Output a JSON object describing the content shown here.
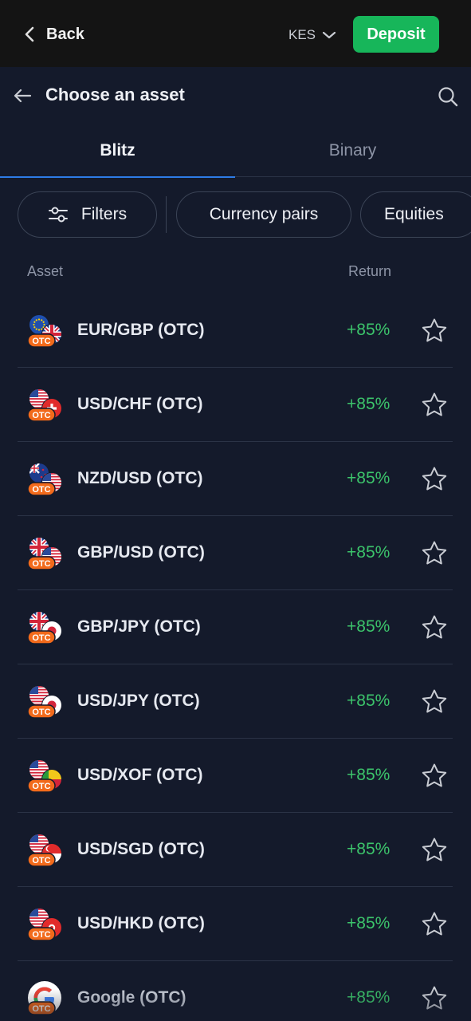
{
  "topbar": {
    "back_label": "Back",
    "currency": "KES",
    "deposit_label": "Deposit"
  },
  "header": {
    "title": "Choose an asset"
  },
  "tabs": [
    {
      "label": "Blitz",
      "active": true
    },
    {
      "label": "Binary",
      "active": false
    }
  ],
  "filters": {
    "filters_label": "Filters",
    "chips": [
      "Currency pairs",
      "Equities"
    ]
  },
  "columns": {
    "asset": "Asset",
    "return": "Return"
  },
  "assets": [
    {
      "name": "EUR/GBP (OTC)",
      "return": "+85%",
      "badge": "OTC",
      "base": "eu",
      "quote": "uk"
    },
    {
      "name": "USD/CHF (OTC)",
      "return": "+85%",
      "badge": "OTC",
      "base": "us",
      "quote": "ch"
    },
    {
      "name": "NZD/USD (OTC)",
      "return": "+85%",
      "badge": "OTC",
      "base": "nz",
      "quote": "us"
    },
    {
      "name": "GBP/USD (OTC)",
      "return": "+85%",
      "badge": "OTC",
      "base": "uk",
      "quote": "us"
    },
    {
      "name": "GBP/JPY (OTC)",
      "return": "+85%",
      "badge": "OTC",
      "base": "uk",
      "quote": "jp"
    },
    {
      "name": "USD/JPY (OTC)",
      "return": "+85%",
      "badge": "OTC",
      "base": "us",
      "quote": "jp"
    },
    {
      "name": "USD/XOF (OTC)",
      "return": "+85%",
      "badge": "OTC",
      "base": "us",
      "quote": "xof"
    },
    {
      "name": "USD/SGD (OTC)",
      "return": "+85%",
      "badge": "OTC",
      "base": "us",
      "quote": "sg"
    },
    {
      "name": "USD/HKD (OTC)",
      "return": "+85%",
      "badge": "OTC",
      "base": "us",
      "quote": "hk"
    },
    {
      "name": "Google (OTC)",
      "return": "+85%",
      "badge": "OTC",
      "base": "google",
      "quote": ""
    }
  ],
  "colors": {
    "background": "#141a2b",
    "topbar": "#141414",
    "deposit": "#17b65a",
    "positive": "#3cc46b",
    "tab_indicator": "#2d7be6",
    "otc_badge": "#f26a1b"
  },
  "icons": {
    "back": "chevron-left-icon",
    "currency": "chevron-down-icon",
    "header_back": "arrow-left-icon",
    "search": "search-icon",
    "filters": "sliders-icon",
    "favorite": "star-outline-icon"
  }
}
